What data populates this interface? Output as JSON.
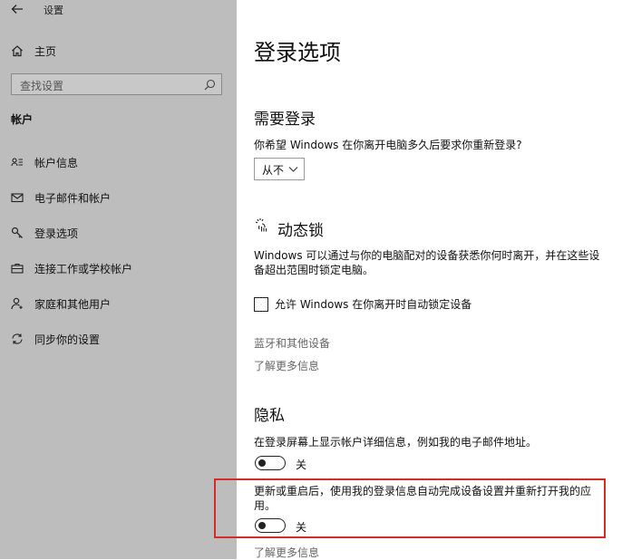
{
  "window": {
    "title": "设置"
  },
  "sidebar": {
    "home_label": "主页",
    "search_placeholder": "查找设置",
    "section_label": "帐户",
    "items": [
      {
        "label": "帐户信息",
        "icon": "person-card-icon"
      },
      {
        "label": "电子邮件和帐户",
        "icon": "mail-icon"
      },
      {
        "label": "登录选项",
        "icon": "key-icon",
        "selected": true
      },
      {
        "label": "连接工作或学校帐户",
        "icon": "briefcase-icon"
      },
      {
        "label": "家庭和其他用户",
        "icon": "person-add-icon"
      },
      {
        "label": "同步你的设置",
        "icon": "sync-icon"
      }
    ]
  },
  "main": {
    "page_title": "登录选项",
    "require_signin": {
      "heading": "需要登录",
      "question": "你希望 Windows 在你离开电脑多久后要求你重新登录?",
      "dropdown_value": "从不"
    },
    "dynamic_lock": {
      "heading": "动态锁",
      "description_line1": "Windows 可以通过与你的电脑配对的设备获悉你何时离开，并在这些设",
      "description_line2": "备超出范围时锁定电脑。",
      "checkbox_label": "允许 Windows 在你离开时自动锁定设备",
      "checkbox_checked": false,
      "link_bluetooth": "蓝牙和其他设备",
      "link_learn_more": "了解更多信息"
    },
    "privacy": {
      "heading": "隐私",
      "setting1_text": "在登录屏幕上显示帐户详细信息，例如我的电子邮件地址。",
      "setting1_state": "关",
      "setting2_text_line1": "更新或重启后，使用我的登录信息自动完成设备设置并重新打开我的应",
      "setting2_text_line2": "用。",
      "setting2_state": "关",
      "link_learn_more": "了解更多信息"
    }
  },
  "colors": {
    "sidebar_bg": "#bdbdbd",
    "highlight_border": "#d62b2b"
  }
}
